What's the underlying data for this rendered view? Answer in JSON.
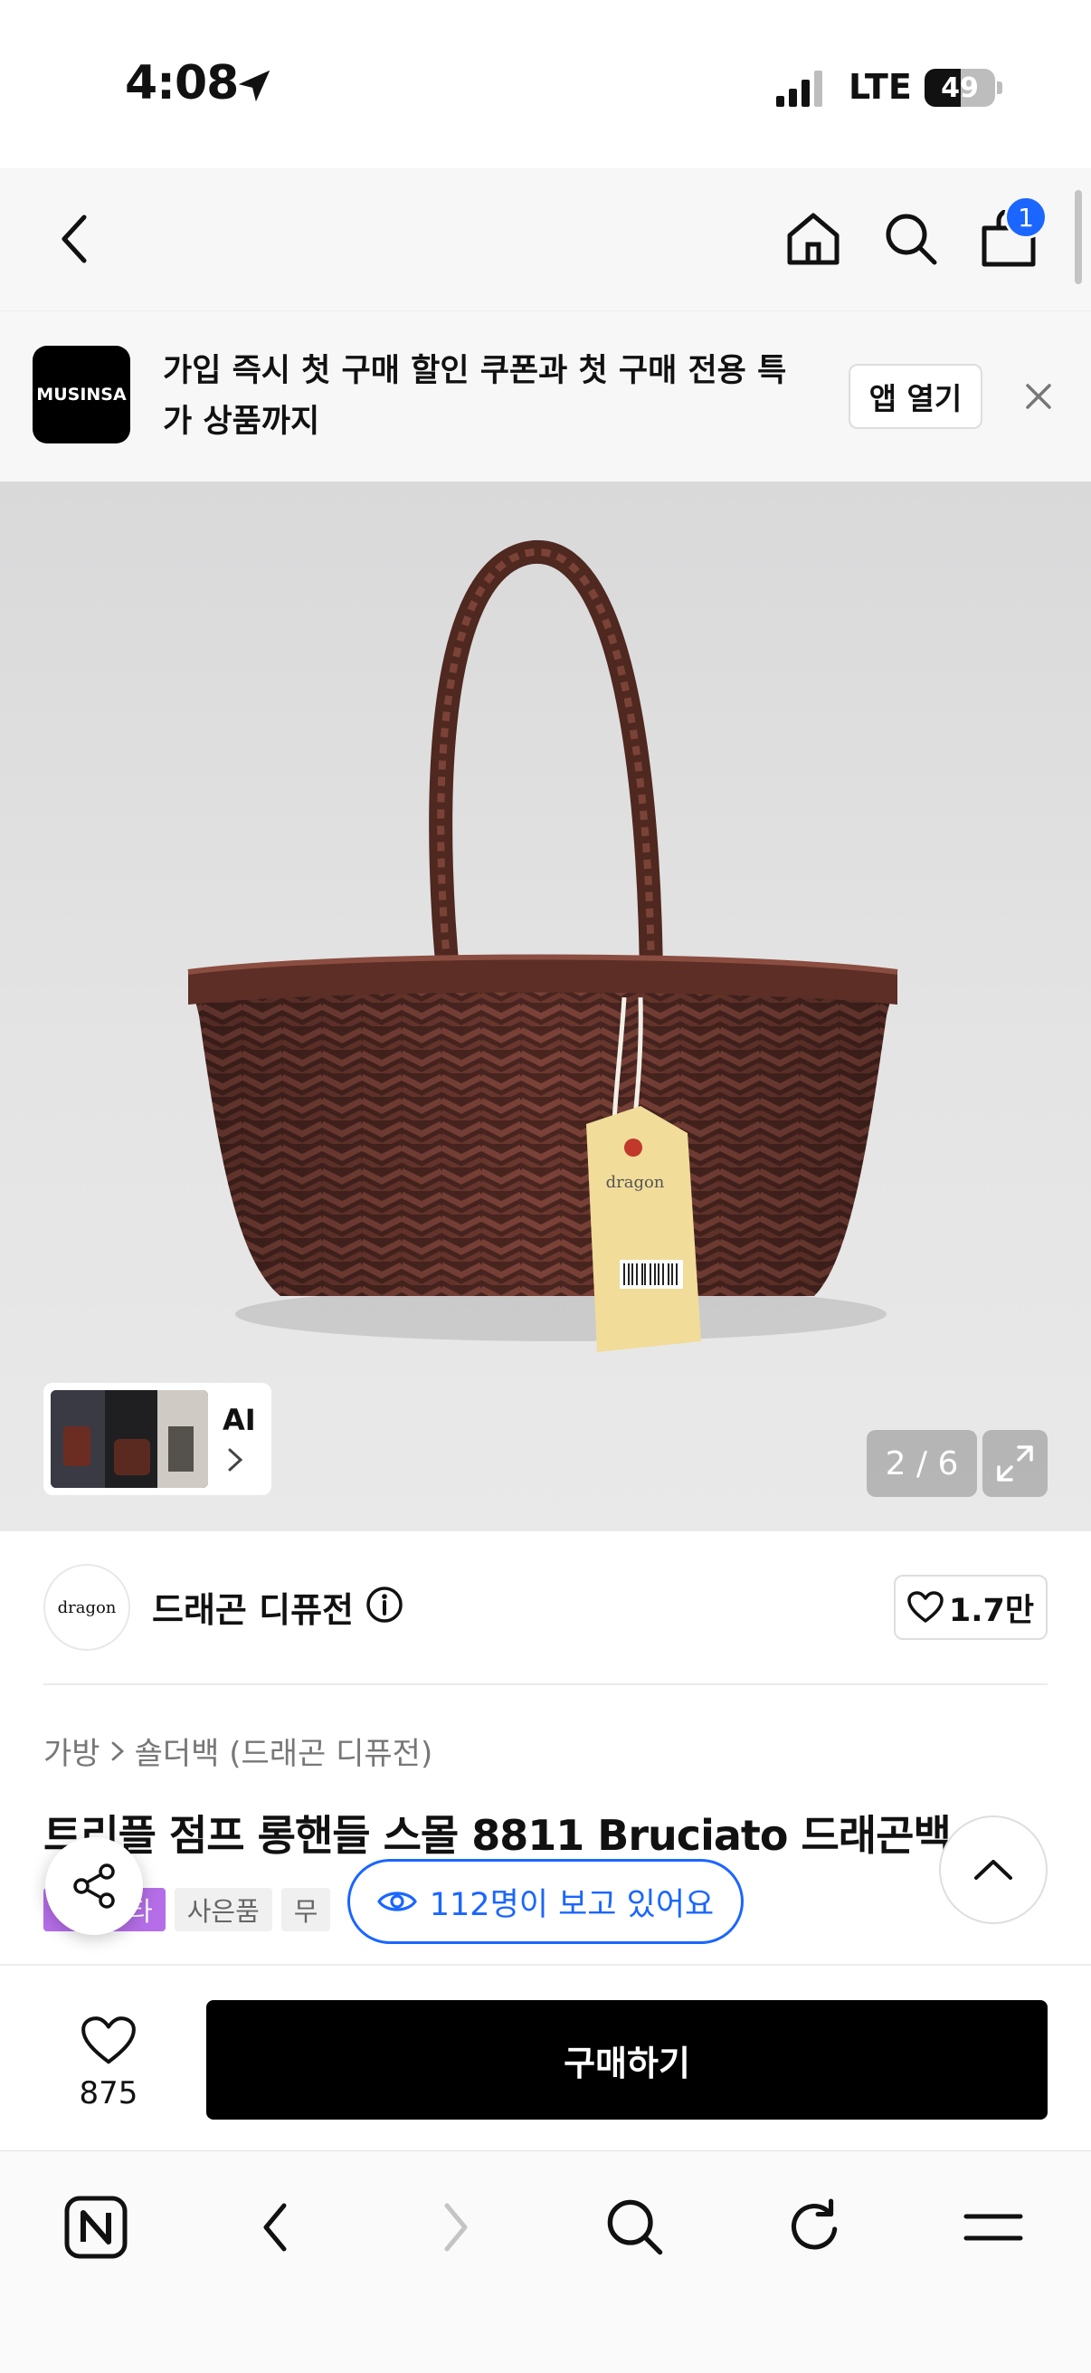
{
  "status_bar": {
    "time": "4:08",
    "network": "LTE",
    "battery": "49"
  },
  "nav": {
    "cart_count": "1"
  },
  "app_banner": {
    "logo_text": "MUSINSA",
    "message": "가입 즉시 첫 구매 할인 쿠폰과 첫 구매 전용 특가 상품까지",
    "open_app_label": "앱 열기"
  },
  "gallery": {
    "ai_label": "AI",
    "counter": "2 / 6",
    "tag_brand": "dragon"
  },
  "brand": {
    "logo_text": "dragon",
    "name": "드래곤 디퓨전",
    "likes": "1.7만"
  },
  "breadcrumb": {
    "category": "가방",
    "subcategory": "숄더백 (드래곤 디퓨전)"
  },
  "product": {
    "title": "트리플 점프 롱핸들 스몰 8811 Bruciato 드래곤백",
    "tags": [
      "패션스타",
      "사은품",
      "무"
    ]
  },
  "viewers": {
    "text": "112명이 보고 있어요"
  },
  "purchase": {
    "wish_count": "875",
    "buy_label": "구매하기"
  },
  "colors": {
    "accent_blue": "#1a66ff",
    "tag_purple": "#b56ee8",
    "buy_black": "#000000",
    "basket_brown": "#5b2e25"
  }
}
